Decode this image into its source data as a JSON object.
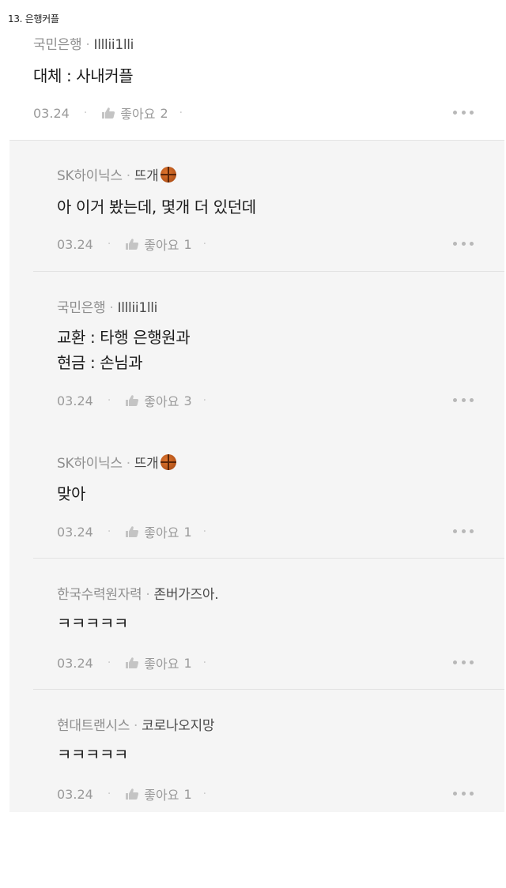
{
  "post_title": "13. 은행커플",
  "main_comment": {
    "company": "국민은행",
    "nick": "Illlii1lli",
    "lines": [
      "대체 : 사내커플"
    ],
    "date": "03.24",
    "like_label": "좋아요",
    "like_count": "2"
  },
  "replies": [
    {
      "company": "SK하이닉스",
      "nick": "뜨개",
      "has_emoji": true,
      "lines": [
        "아 이거 봤는데, 몇개 더 있던데"
      ],
      "date": "03.24",
      "like_label": "좋아요",
      "like_count": "1"
    },
    {
      "company": "국민은행",
      "nick": "Illlii1lli",
      "has_emoji": false,
      "lines": [
        "교환 : 타행 은행원과",
        "현금 : 손님과"
      ],
      "date": "03.24",
      "like_label": "좋아요",
      "like_count": "3"
    },
    {
      "company": "SK하이닉스",
      "nick": "뜨개",
      "has_emoji": true,
      "lines": [
        "맞아"
      ],
      "date": "03.24",
      "like_label": "좋아요",
      "like_count": "1"
    },
    {
      "company": "한국수력원자력",
      "nick": "존버가즈아.",
      "has_emoji": false,
      "lines": [
        "ㅋㅋㅋㅋㅋ"
      ],
      "date": "03.24",
      "like_label": "좋아요",
      "like_count": "1"
    },
    {
      "company": "현대트랜시스",
      "nick": "코로나오지망",
      "has_emoji": false,
      "lines": [
        "ㅋㅋㅋㅋㅋ"
      ],
      "date": "03.24",
      "like_label": "좋아요",
      "like_count": "1"
    }
  ],
  "separator_dot": "·",
  "icons": {
    "thumb": "thumbs-up-icon",
    "more": "more-dots-icon",
    "emoji": "basketball-emoji-icon"
  }
}
